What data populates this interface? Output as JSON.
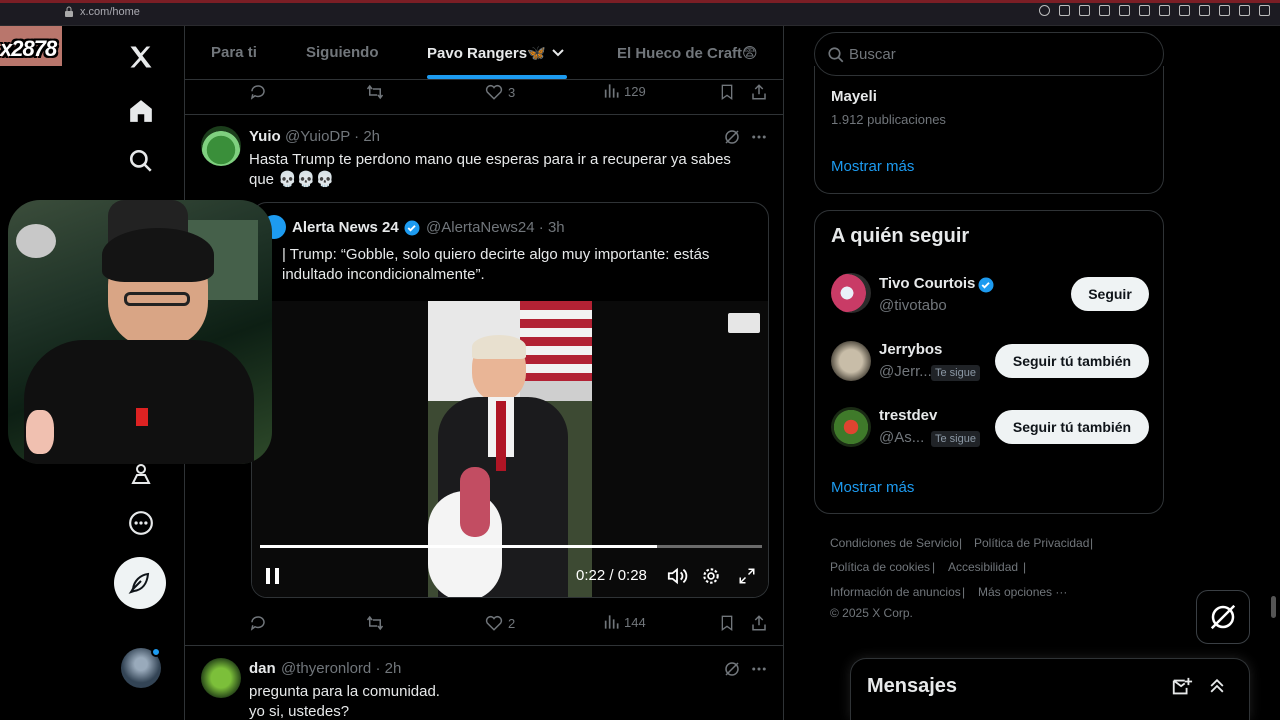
{
  "browser": {
    "url": "x.com/home"
  },
  "streamer": {
    "name": "x2878"
  },
  "nav": {
    "items": [
      "x-logo",
      "home",
      "search",
      "communities",
      "more"
    ]
  },
  "tabs": [
    {
      "label": "Para ti",
      "active": false
    },
    {
      "label": "Siguiendo",
      "active": false
    },
    {
      "label": "Pavo Rangers🦋",
      "active": true
    },
    {
      "label": "El Hueco de Craft😨",
      "active": false
    }
  ],
  "prev_actions": {
    "likes": "3",
    "views": "129"
  },
  "post1": {
    "name": "Yuio",
    "handle": "@YuioDP",
    "time": "· 2h",
    "text": "Hasta Trump te perdono mano que esperas para ir a recuperar ya sabes que 💀💀💀",
    "quote": {
      "name": "Alerta News 24",
      "handle": "@AlertaNews24",
      "time": "· 3h",
      "text": "| Trump: “Gobble, solo quiero decirte algo muy importante: estás indultado incondicionalmente”.",
      "video": {
        "time": "0:22 / 0:28",
        "progress": 0.79
      }
    },
    "actions": {
      "likes": "2",
      "views": "144"
    }
  },
  "post2": {
    "name": "dan",
    "handle": "@thyeronlord",
    "time": "· 2h",
    "text_line1": "pregunta para la comunidad.",
    "text_line2": "yo si, ustedes?"
  },
  "right": {
    "search_placeholder": "Buscar",
    "trend": {
      "name": "Mayeli",
      "count": "1.912 publicaciones",
      "show_more": "Mostrar más"
    },
    "who_to_follow": {
      "title": "A quién seguir",
      "users": [
        {
          "name": "Tivo Courtois",
          "handle": "@tivotabo",
          "button": "Seguir",
          "follows_you": ""
        },
        {
          "name": "Jerrybos",
          "handle": "@Jerr...",
          "button": "Seguir tú también",
          "follows_you": "Te sigue"
        },
        {
          "name": "trestdev",
          "handle": "@As...",
          "button": "Seguir tú también",
          "follows_you": "Te sigue"
        }
      ],
      "show_more": "Mostrar más"
    },
    "footer": {
      "terms": "Condiciones de Servicio",
      "privacy": "Política de Privacidad",
      "cookies": "Política de cookies",
      "accessibility": "Accesibilidad",
      "ads": "Información de anuncios",
      "more": "Más opciones ···",
      "copyright": "© 2025 X Corp."
    },
    "messages_title": "Mensajes"
  },
  "colors": {
    "accent": "#1d9bf0",
    "border": "#2f3336",
    "muted": "#71767b"
  }
}
